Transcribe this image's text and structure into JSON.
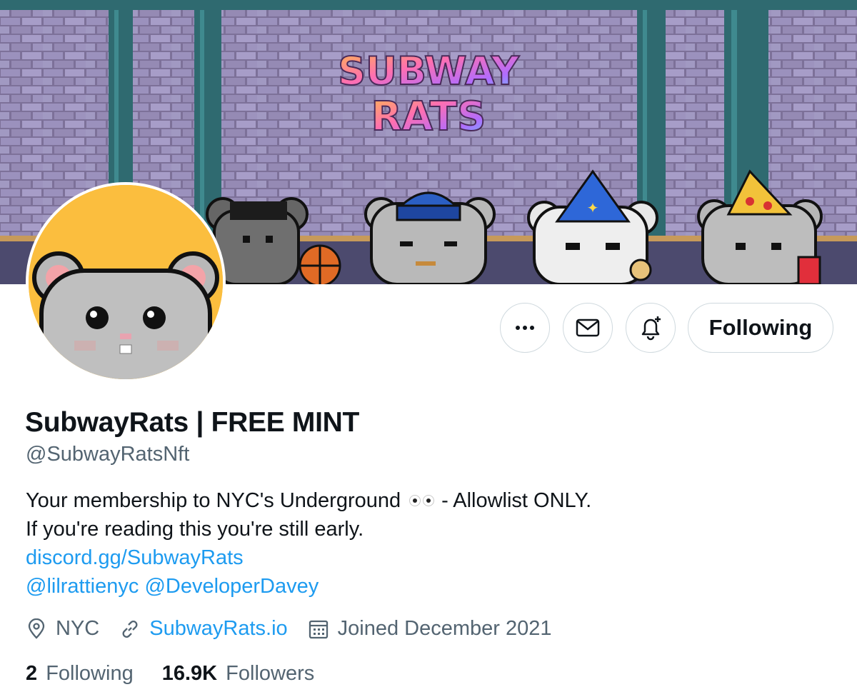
{
  "banner": {
    "logo_line1": "SUBWAY",
    "logo_line2": "RATS"
  },
  "profile": {
    "display_name": "SubwayRats | FREE MINT",
    "handle": "@SubwayRatsNft",
    "bio": {
      "line1_a": "Your membership to NYC's Underground",
      "line1_emoji": "eyes-emoji",
      "line1_b": "- Allowlist ONLY.",
      "line2": "If you're reading this you're still early.",
      "link": "discord.gg/SubwayRats",
      "mention1": "@lilrattienyc",
      "mention2": "@DeveloperDavey"
    },
    "location": "NYC",
    "website": "SubwayRats.io",
    "joined": "Joined December 2021"
  },
  "actions": {
    "more_icon": "more-icon",
    "message_icon": "mail-icon",
    "notify_icon": "bell-plus-icon",
    "following_label": "Following"
  },
  "stats": {
    "following_count": "2",
    "following_label": "Following",
    "followers_count": "16.9K",
    "followers_label": "Followers"
  },
  "colors": {
    "link": "#1d9bf0",
    "secondary_text": "#536471",
    "primary_text": "#0f1419",
    "button_border": "#cfd9de",
    "avatar_bg": "#fbbe3e"
  }
}
